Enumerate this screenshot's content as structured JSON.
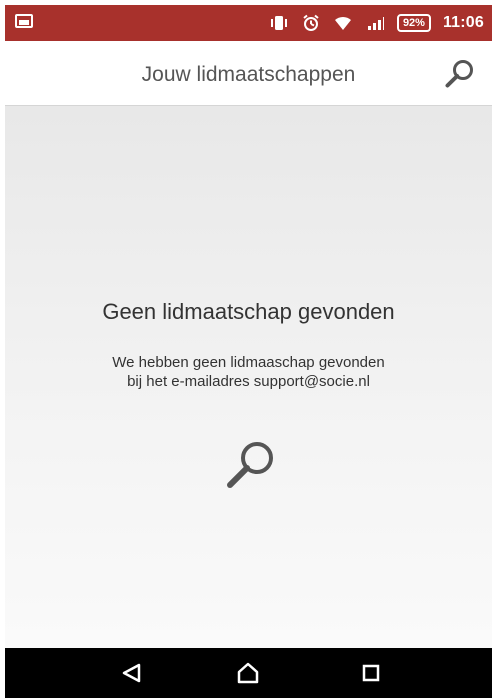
{
  "status_bar": {
    "battery": "92%",
    "time": "11:06",
    "icons": [
      "image-notification-icon",
      "vibrate-icon",
      "alarm-icon",
      "wifi-icon",
      "signal-icon",
      "battery-icon"
    ]
  },
  "app_bar": {
    "title": "Jouw lidmaatschappen",
    "search_icon": "search-icon"
  },
  "empty_state": {
    "title": "Geen lidmaatschap gevonden",
    "line1": "We hebben geen lidmaaschap gevonden",
    "line2": "bij het e-mailadres support@socie.nl",
    "icon": "search-icon"
  },
  "nav_bar": {
    "back_icon": "back-icon",
    "home_icon": "home-icon",
    "recent_icon": "recent-apps-icon"
  },
  "colors": {
    "status_bar": "#a8312c",
    "app_bar": "#ffffff",
    "background_top": "#e8e8e8",
    "background_bottom": "#fafafa",
    "nav_bar": "#000000",
    "icon": "#555555"
  }
}
